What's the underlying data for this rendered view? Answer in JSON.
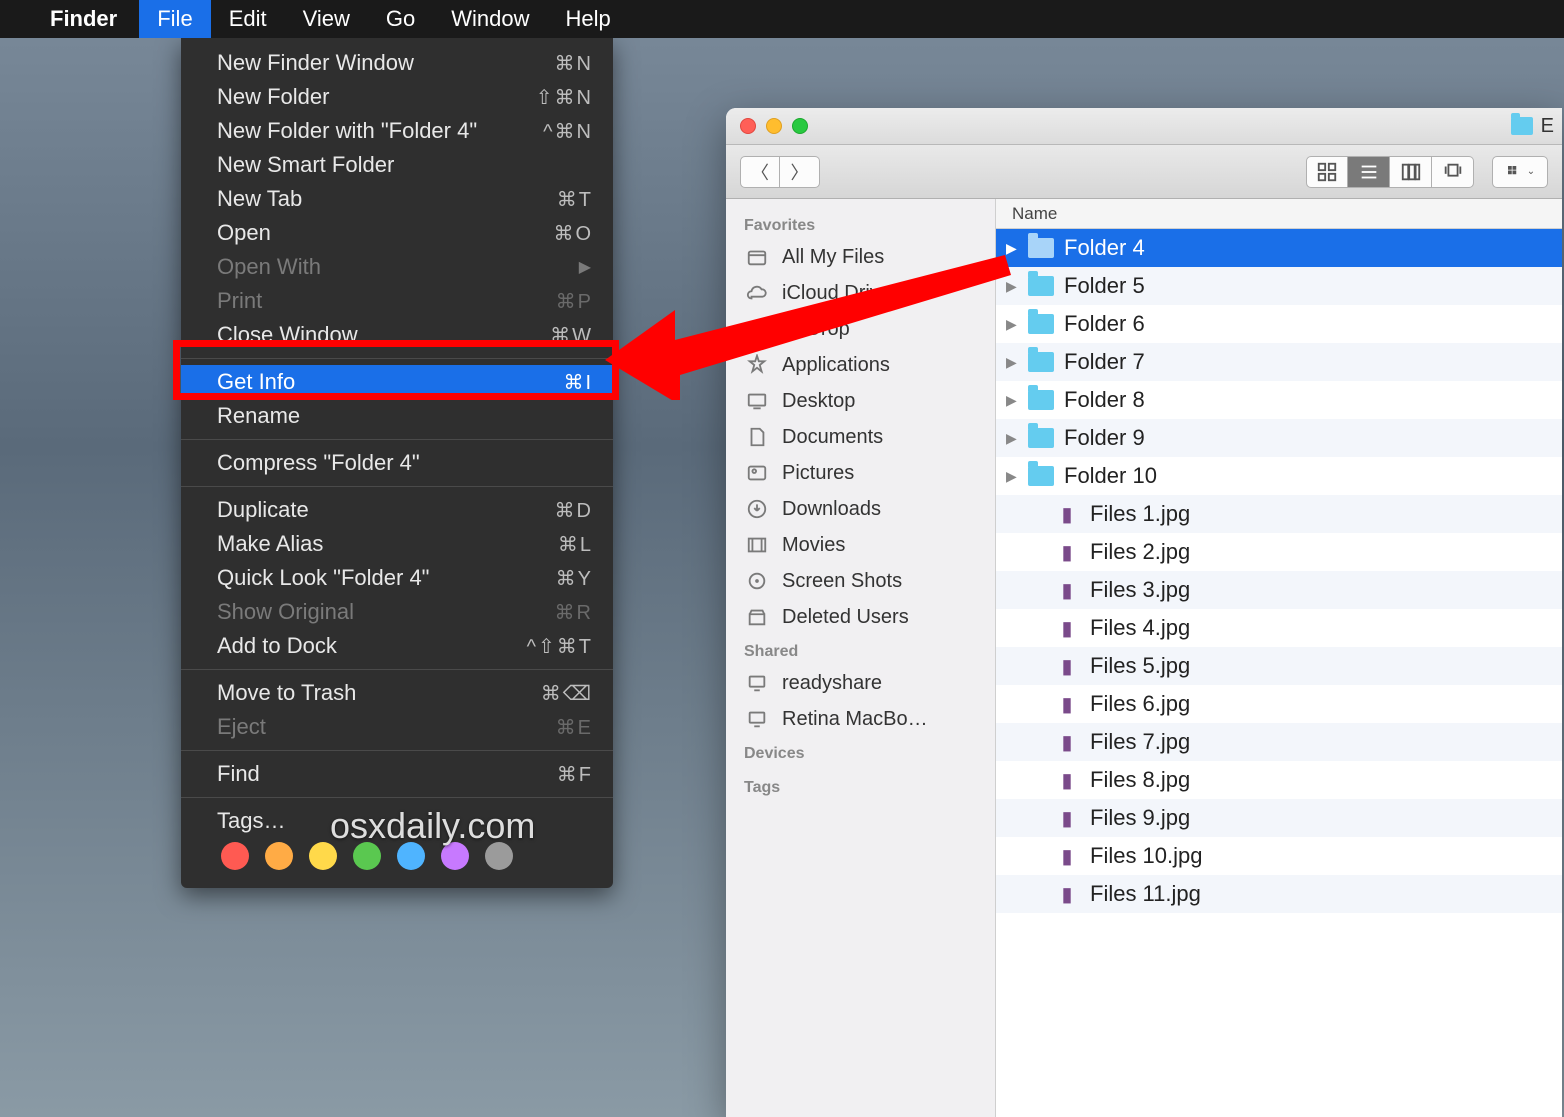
{
  "menubar": {
    "app": "Finder",
    "items": [
      "File",
      "Edit",
      "View",
      "Go",
      "Window",
      "Help"
    ],
    "active_index": 0
  },
  "dropdown": {
    "sections": [
      [
        {
          "label": "New Finder Window",
          "shortcut": "⌘N"
        },
        {
          "label": "New Folder",
          "shortcut": "⇧⌘N"
        },
        {
          "label": "New Folder with \"Folder 4\"",
          "shortcut": "^⌘N"
        },
        {
          "label": "New Smart Folder",
          "shortcut": ""
        },
        {
          "label": "New Tab",
          "shortcut": "⌘T"
        },
        {
          "label": "Open",
          "shortcut": "⌘O"
        },
        {
          "label": "Open With",
          "shortcut": "",
          "disabled": true,
          "submenu": true
        },
        {
          "label": "Print",
          "shortcut": "⌘P",
          "disabled": true
        },
        {
          "label": "Close Window",
          "shortcut": "⌘W"
        }
      ],
      [
        {
          "label": "Get Info",
          "shortcut": "⌘I",
          "highlighted": true
        },
        {
          "label": "Rename",
          "shortcut": ""
        }
      ],
      [
        {
          "label": "Compress \"Folder 4\"",
          "shortcut": ""
        }
      ],
      [
        {
          "label": "Duplicate",
          "shortcut": "⌘D"
        },
        {
          "label": "Make Alias",
          "shortcut": "⌘L"
        },
        {
          "label": "Quick Look \"Folder 4\"",
          "shortcut": "⌘Y"
        },
        {
          "label": "Show Original",
          "shortcut": "⌘R",
          "disabled": true
        },
        {
          "label": "Add to Dock",
          "shortcut": "^⇧⌘T"
        }
      ],
      [
        {
          "label": "Move to Trash",
          "shortcut": "⌘⌫"
        },
        {
          "label": "Eject",
          "shortcut": "⌘E",
          "disabled": true
        }
      ],
      [
        {
          "label": "Find",
          "shortcut": "⌘F"
        }
      ]
    ],
    "tags_label": "Tags…",
    "tag_colors": [
      "#ff5a52",
      "#ffab45",
      "#ffd94a",
      "#5ac850",
      "#4fb4ff",
      "#c779ff",
      "#9b9b9b"
    ]
  },
  "finder": {
    "title": "E",
    "sidebar": {
      "favorites_head": "Favorites",
      "favorites": [
        "All My Files",
        "iCloud Drive",
        "AirDrop",
        "Applications",
        "Desktop",
        "Documents",
        "Pictures",
        "Downloads",
        "Movies",
        "Screen Shots",
        "Deleted Users"
      ],
      "shared_head": "Shared",
      "shared": [
        "readyshare",
        "Retina MacBo…"
      ],
      "devices_head": "Devices",
      "tags_head": "Tags"
    },
    "list": {
      "header": "Name",
      "folders": [
        "Folder 4",
        "Folder 5",
        "Folder 6",
        "Folder 7",
        "Folder 8",
        "Folder 9",
        "Folder 10"
      ],
      "files": [
        "Files 1.jpg",
        "Files 2.jpg",
        "Files 3.jpg",
        "Files 4.jpg",
        "Files 5.jpg",
        "Files 6.jpg",
        "Files 7.jpg",
        "Files 8.jpg",
        "Files 9.jpg",
        "Files 10.jpg",
        "Files 11.jpg"
      ],
      "selected_index": 0
    }
  },
  "watermark": "osxdaily.com"
}
